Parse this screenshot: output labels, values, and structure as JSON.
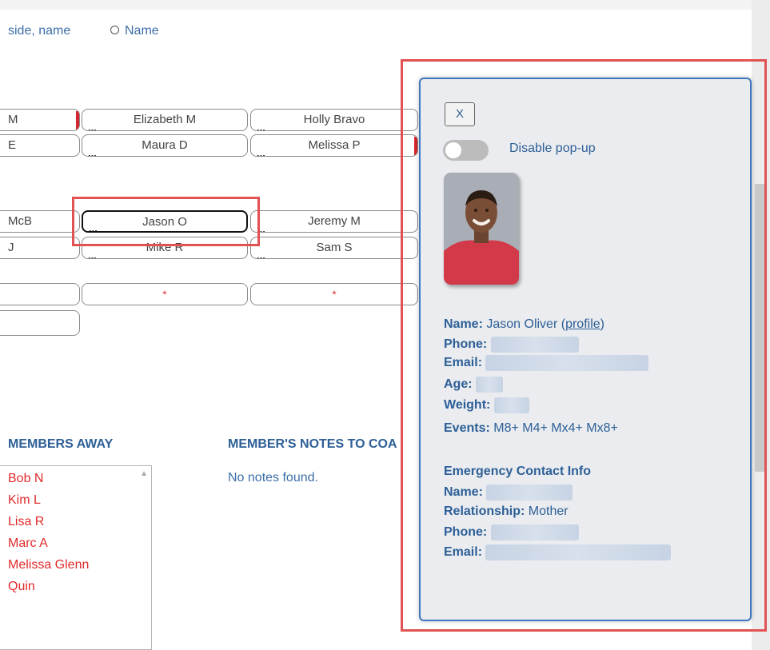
{
  "header": {
    "sort_option_1": "side, name",
    "sort_option_2": "Name"
  },
  "boats": {
    "row1": [
      "M",
      "Elizabeth M",
      "Holly Bravo"
    ],
    "row2": [
      "E",
      "Maura D",
      "Melissa P"
    ],
    "row3": [
      "McB",
      "Jason O",
      "Jeremy M"
    ],
    "row4": [
      "J",
      "Mike R",
      "Sam S"
    ],
    "row5": [
      "",
      "*",
      "*"
    ],
    "seat_menu": "..."
  },
  "members_away": {
    "heading": "MEMBERS AWAY",
    "items": [
      "Bob N",
      "Kim L",
      "Lisa R",
      "Marc A",
      "Melissa Glenn",
      "Quin"
    ]
  },
  "notes": {
    "heading": "MEMBER'S NOTES TO COA",
    "empty_text": "No notes found."
  },
  "popup": {
    "close_label": "X",
    "toggle_label": "Disable pop-up",
    "toggle_on": false,
    "name_label": "Name:",
    "name_value": "Jason Oliver",
    "profile_link": "profile",
    "phone_label": "Phone:",
    "email_label": "Email:",
    "age_label": "Age:",
    "weight_label": "Weight:",
    "events_label": "Events:",
    "events_value": "M8+ M4+ Mx4+ Mx8+",
    "emergency_heading": "Emergency Contact Info",
    "ec_name_label": "Name:",
    "ec_relationship_label": "Relationship:",
    "ec_relationship_value": "Mother",
    "ec_phone_label": "Phone:",
    "ec_email_label": "Email:"
  },
  "colors": {
    "accent_blue": "#2d5f97",
    "highlight_red": "#e35252",
    "away_red": "#e02a2a"
  }
}
